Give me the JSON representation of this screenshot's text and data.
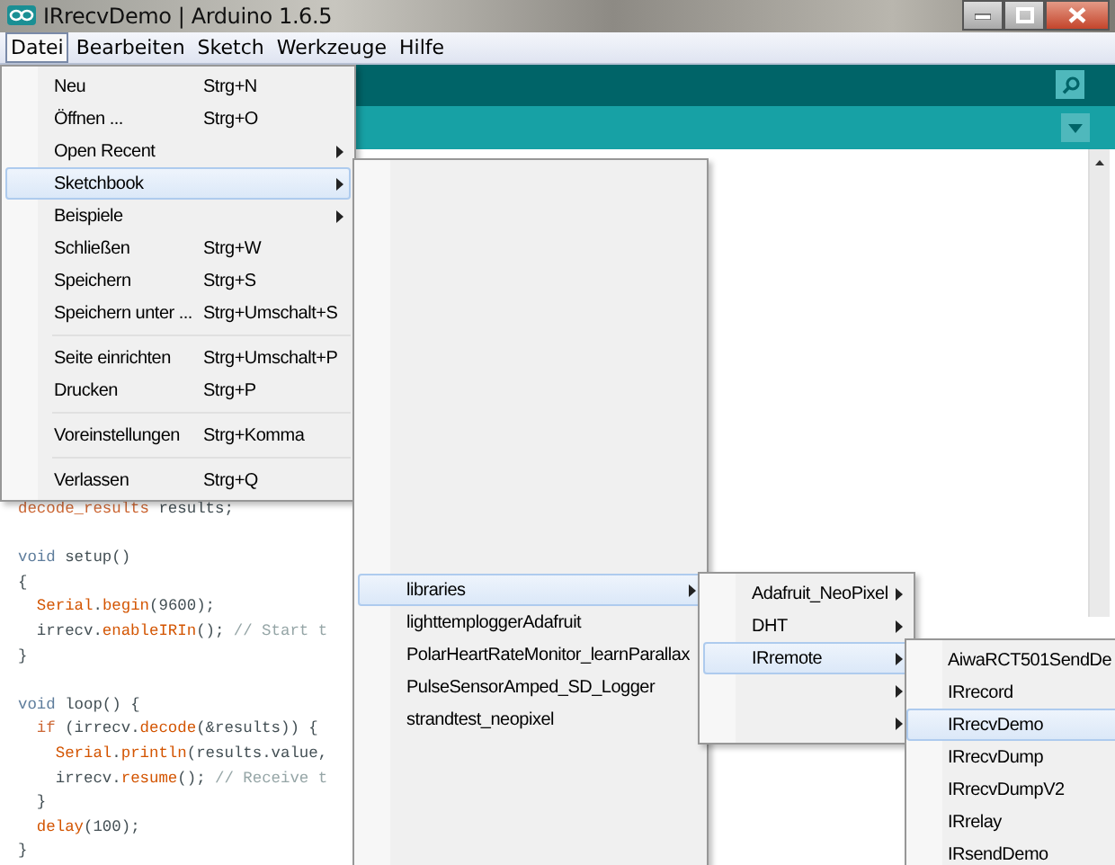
{
  "window": {
    "title": "IRrecvDemo | Arduino 1.6.5"
  },
  "menu_bar": [
    {
      "label": "Datei",
      "selected": true
    },
    {
      "label": "Bearbeiten",
      "selected": false
    },
    {
      "label": "Sketch",
      "selected": false
    },
    {
      "label": "Werkzeuge",
      "selected": false
    },
    {
      "label": "Hilfe",
      "selected": false
    }
  ],
  "file_menu": [
    {
      "kind": "item",
      "label": "Neu",
      "shortcut": "Strg+N",
      "submenu": false,
      "selected": false
    },
    {
      "kind": "item",
      "label": "Öffnen ...",
      "shortcut": "Strg+O",
      "submenu": false,
      "selected": false
    },
    {
      "kind": "item",
      "label": "Open Recent",
      "submenu": true,
      "selected": false
    },
    {
      "kind": "item",
      "label": "Sketchbook",
      "submenu": true,
      "selected": true
    },
    {
      "kind": "item",
      "label": "Beispiele",
      "submenu": true,
      "selected": false
    },
    {
      "kind": "item",
      "label": "Schließen",
      "shortcut": "Strg+W",
      "submenu": false,
      "selected": false
    },
    {
      "kind": "item",
      "label": "Speichern",
      "shortcut": "Strg+S",
      "submenu": false,
      "selected": false
    },
    {
      "kind": "item",
      "label": "Speichern unter ...",
      "shortcut": "Strg+Umschalt+S",
      "submenu": false,
      "selected": false
    },
    {
      "kind": "separator"
    },
    {
      "kind": "item",
      "label": "Seite einrichten",
      "shortcut": "Strg+Umschalt+P",
      "submenu": false,
      "selected": false
    },
    {
      "kind": "item",
      "label": "Drucken",
      "shortcut": "Strg+P",
      "submenu": false,
      "selected": false
    },
    {
      "kind": "separator"
    },
    {
      "kind": "item",
      "label": "Voreinstellungen",
      "shortcut": "Strg+Komma",
      "submenu": false,
      "selected": false
    },
    {
      "kind": "separator"
    },
    {
      "kind": "item",
      "label": "Verlassen",
      "shortcut": "Strg+Q",
      "submenu": false,
      "selected": false
    }
  ],
  "sketchbook_menu": [
    {
      "label": "libraries",
      "submenu": true,
      "selected": true
    },
    {
      "label": "lighttemploggerAdafruit",
      "submenu": false,
      "selected": false
    },
    {
      "label": "PolarHeartRateMonitor_learnParallax",
      "submenu": false,
      "selected": false
    },
    {
      "label": "PulseSensorAmped_SD_Logger",
      "submenu": false,
      "selected": false
    },
    {
      "label": "strandtest_neopixel",
      "submenu": false,
      "selected": false
    }
  ],
  "libraries_menu": [
    {
      "label": "Adafruit_NeoPixel",
      "submenu": true,
      "selected": false
    },
    {
      "label": "DHT",
      "submenu": true,
      "selected": false
    },
    {
      "label": "IRremote",
      "submenu": true,
      "selected": true
    },
    {
      "submenu": true,
      "selected": false
    },
    {
      "submenu": true,
      "selected": false
    }
  ],
  "irremote_menu": [
    {
      "label": "AiwaRCT501SendDe",
      "selected": false
    },
    {
      "label": "IRrecord",
      "selected": false
    },
    {
      "label": "IRrecvDemo",
      "selected": true
    },
    {
      "label": "IRrecvDump",
      "selected": false
    },
    {
      "label": "IRrecvDumpV2",
      "selected": false
    },
    {
      "label": "IRrelay",
      "selected": false
    },
    {
      "label": "IRsendDemo",
      "selected": false
    }
  ],
  "code_lines": [
    {
      "kind": "code",
      "segments": [
        {
          "text": "decode_results",
          "kind": "type"
        },
        {
          "text": " results;",
          "kind": "plain"
        }
      ]
    },
    {
      "kind": "blank"
    },
    {
      "kind": "code",
      "segments": [
        {
          "text": "void",
          "kind": "keyword"
        },
        {
          "text": " setup()",
          "kind": "plain"
        }
      ]
    },
    {
      "kind": "code",
      "segments": [
        {
          "text": "{",
          "kind": "plain"
        }
      ]
    },
    {
      "kind": "code",
      "segments": [
        {
          "text": "  Serial",
          "kind": "function"
        },
        {
          "text": ".",
          "kind": "plain"
        },
        {
          "text": "begin",
          "kind": "function"
        },
        {
          "text": "(9600);",
          "kind": "plain"
        }
      ]
    },
    {
      "kind": "code",
      "segments": [
        {
          "text": "  irrecv.",
          "kind": "plain"
        },
        {
          "text": "enableIRIn",
          "kind": "function"
        },
        {
          "text": "(); ",
          "kind": "plain"
        },
        {
          "text": "// Start t",
          "kind": "comment"
        }
      ]
    },
    {
      "kind": "code",
      "segments": [
        {
          "text": "}",
          "kind": "plain"
        }
      ]
    },
    {
      "kind": "blank"
    },
    {
      "kind": "code",
      "segments": [
        {
          "text": "void",
          "kind": "keyword"
        },
        {
          "text": " loop() {",
          "kind": "plain"
        }
      ]
    },
    {
      "kind": "code",
      "segments": [
        {
          "text": "  if",
          "kind": "type"
        },
        {
          "text": " (irrecv.",
          "kind": "plain"
        },
        {
          "text": "decode",
          "kind": "function"
        },
        {
          "text": "(&results)) {",
          "kind": "plain"
        }
      ]
    },
    {
      "kind": "code",
      "segments": [
        {
          "text": "    Serial",
          "kind": "function"
        },
        {
          "text": ".",
          "kind": "plain"
        },
        {
          "text": "println",
          "kind": "function"
        },
        {
          "text": "(results.value,",
          "kind": "plain"
        }
      ]
    },
    {
      "kind": "code",
      "segments": [
        {
          "text": "    irrecv.",
          "kind": "plain"
        },
        {
          "text": "resume",
          "kind": "function"
        },
        {
          "text": "(); ",
          "kind": "plain"
        },
        {
          "text": "// Receive t",
          "kind": "comment"
        }
      ]
    },
    {
      "kind": "code",
      "segments": [
        {
          "text": "  }",
          "kind": "plain"
        }
      ]
    },
    {
      "kind": "code",
      "segments": [
        {
          "text": "  delay",
          "kind": "function"
        },
        {
          "text": "(100);",
          "kind": "plain"
        }
      ]
    },
    {
      "kind": "code",
      "segments": [
        {
          "text": "}",
          "kind": "plain"
        }
      ]
    }
  ]
}
